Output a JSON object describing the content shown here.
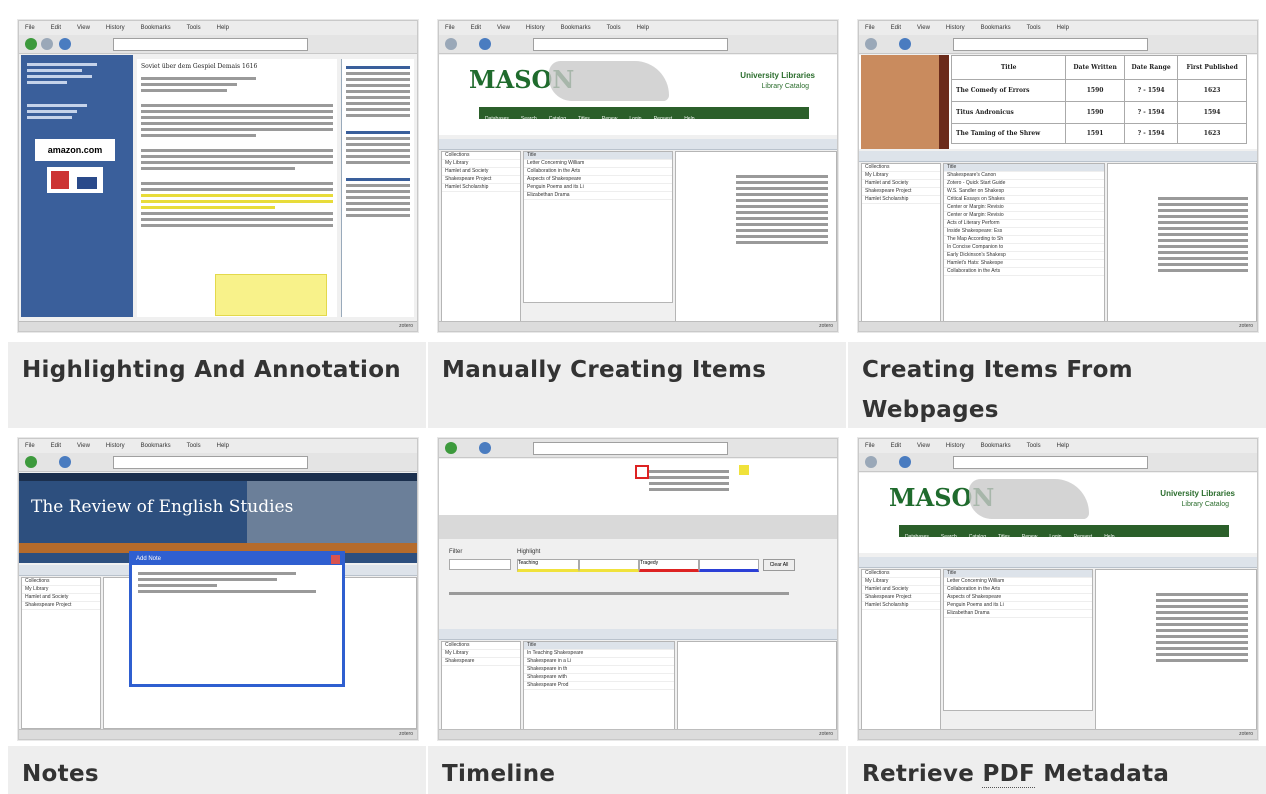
{
  "tiles": [
    {
      "caption": "Highlighting And Annotation",
      "caption2": ""
    },
    {
      "caption": "Manually Creating Items",
      "caption2": ""
    },
    {
      "caption": "Creating Items From",
      "caption2": "Webpages"
    },
    {
      "caption": "Notes",
      "caption2": ""
    },
    {
      "caption": "Timeline",
      "caption2": ""
    },
    {
      "caption_pre": "Retrieve ",
      "caption_pdf": "PDF",
      "caption_post": " Metadata"
    }
  ],
  "thumbs": {
    "t1": {
      "doc_title": "Soviet über dem Gespiel Demais 1616",
      "amazon": "amazon.com"
    },
    "t2": {
      "lib_title": "University Libraries",
      "lib_sub": "Library Catalog",
      "logo": "MASON"
    },
    "t3": {
      "col_title": "Title",
      "col_written": "Date Written",
      "col_range": "Date Range",
      "col_first": "First Published",
      "rows": [
        {
          "title": "The Comedy of Errors",
          "w": "1590",
          "r": "? - 1594",
          "f": "1623"
        },
        {
          "title": "Titus Andronicus",
          "w": "1590",
          "r": "? - 1594",
          "f": "1594"
        },
        {
          "title": "The Taming of the Shrew",
          "w": "1591",
          "r": "? - 1594",
          "f": "1623"
        }
      ]
    },
    "t4": {
      "journal": "The Review of English Studies",
      "note_title": "Add Note"
    },
    "t5": {
      "filter": "Filter",
      "highlight": "Highlight",
      "teaching": "Teaching",
      "tragedy": "Tragedy",
      "clear": "Clear All"
    },
    "t6": {
      "lib_title": "University Libraries",
      "lib_sub": "Library Catalog",
      "logo": "MASON"
    }
  },
  "colors": {
    "caption_bg": "#eeeeee",
    "caption_text": "#333333",
    "mason_green": "#1f6b2d",
    "note_blue": "#2f5fd0"
  }
}
